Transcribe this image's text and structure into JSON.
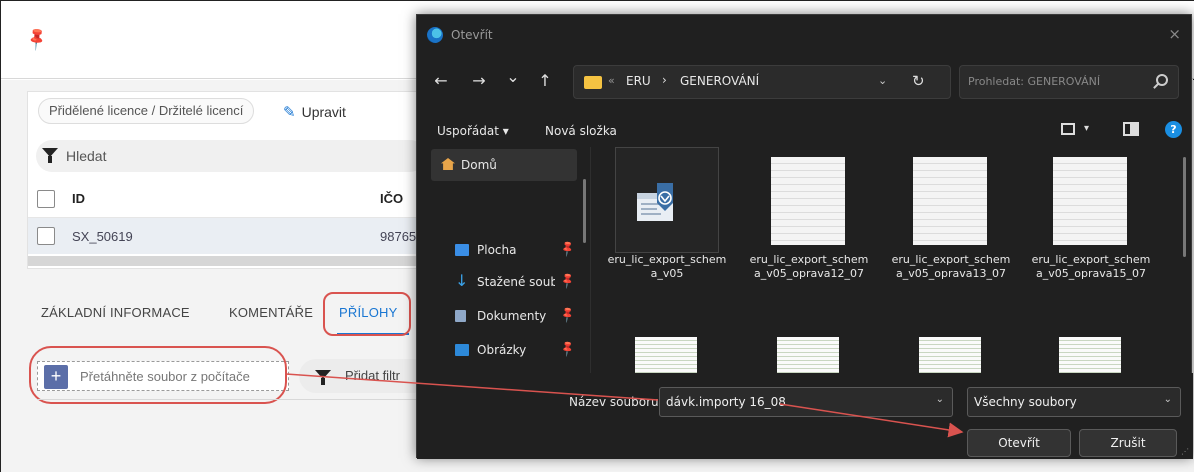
{
  "app": {
    "breadcrumb": "Přidělené licence / Držitelé licencí",
    "edit_label": "Upravit",
    "search_label": "Hledat",
    "columns": {
      "id": "ID",
      "ico": "IČO"
    },
    "row": {
      "id": "SX_50619",
      "ico": "98765"
    },
    "tabs": [
      "ZÁKLADNÍ INFORMACE",
      "KOMENTÁŘE",
      "PŘÍLOHY"
    ],
    "active_tab": "PŘÍLOHY",
    "drop_zone_text": "Přetáhněte soubor z počítače",
    "add_filter_label": "Přidat filtr",
    "accent_color": "#1976d2"
  },
  "dialog": {
    "title": "Otevřít",
    "close_icon": "×",
    "nav": {
      "back": "←",
      "forward": "→",
      "recent": "⌄",
      "up": "↑"
    },
    "address": {
      "overflow": "«",
      "segments": [
        "ERU",
        "GENEROVÁNÍ"
      ],
      "separator": "›",
      "dropdown": "⌄",
      "refresh": "↻"
    },
    "search_placeholder": "Prohledat: GENEROVÁNÍ",
    "toolbar": {
      "organize": "Uspořádat ▾",
      "new_folder": "Nová složka",
      "view_dropdown": "▾",
      "help": "?"
    },
    "nav_pane": {
      "home": "Domů",
      "items": [
        {
          "label": "Plocha",
          "icon": "desktop-icon",
          "color": "#3a8ee6"
        },
        {
          "label": "Stažené soubory",
          "icon": "download-icon",
          "color": "#3aa0e6"
        },
        {
          "label": "Dokumenty",
          "icon": "documents-icon",
          "color": "#8fa8c8"
        },
        {
          "label": "Obrázky",
          "icon": "pictures-icon",
          "color": "#2d89d9"
        }
      ],
      "pin": "📌"
    },
    "files": [
      {
        "name": "eru_lic_export_schema_v05",
        "type": "xml"
      },
      {
        "name": "eru_lic_export_schema_v05_oprava12_07",
        "type": "doc"
      },
      {
        "name": "eru_lic_export_schema_v05_oprava13_07",
        "type": "doc"
      },
      {
        "name": "eru_lic_export_schema_v05_oprava15_07",
        "type": "doc"
      }
    ],
    "filename_label": "Název souboru:",
    "filename_value": "dávk.importy 16_08",
    "file_type_value": "Všechny soubory",
    "open_label": "Otevřít",
    "cancel_label": "Zrušit",
    "dropdown_arrow": "⌄"
  },
  "annotation_color": "#d9534f"
}
